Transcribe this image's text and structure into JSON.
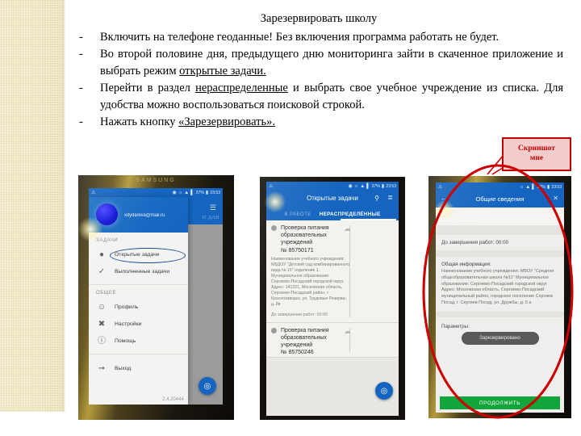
{
  "document": {
    "title": "Зарезервировать школу",
    "bullets": [
      {
        "dash": "-",
        "parts": [
          {
            "t": "Включить на телефоне геоданные! Без включения программа работать не будет.",
            "u": false
          }
        ]
      },
      {
        "dash": "-",
        "parts": [
          {
            "t": "Во второй половине дня, предыдущего дню мониторинга зайти в скаченное приложение и выбрать режим ",
            "u": false
          },
          {
            "t": "открытые задачи.",
            "u": true
          }
        ]
      },
      {
        "dash": "-",
        "parts": [
          {
            "t": "Перейти в раздел ",
            "u": false
          },
          {
            "t": "нераспределенные",
            "u": true
          },
          {
            "t": " и выбрать свое учебное учреждение из списка. Для удобства можно воспользоваться поисковой строкой.",
            "u": false
          }
        ]
      },
      {
        "dash": "-",
        "parts": [
          {
            "t": "Нажать кнопку ",
            "u": false
          },
          {
            "t": "«Зарезервировать».",
            "u": true
          }
        ]
      }
    ]
  },
  "callout": {
    "line1": "Скриншот",
    "line2": "мне",
    "fill": "#f4cccc",
    "stroke": "#c00000"
  },
  "annotation": {
    "ellipse_color": "#cc0000"
  },
  "statusbar": {
    "battery": "37%",
    "clock": "23:53",
    "warning_icon": "warning-triangle-icon",
    "location_icon": "location-pin-icon",
    "bluetooth_icon": "bluetooth-icon",
    "wifi_icon": "wifi-icon",
    "signal_icon": "signal-bars-icon",
    "battery_icon": "battery-icon"
  },
  "phone1": {
    "brand": "SAMSUNG",
    "drawer": {
      "email": "xdydareva@mail.ru",
      "avatar_icon": "user-avatar",
      "sections": [
        {
          "label": "ЗАДАЧИ",
          "items": [
            {
              "label": "Открытые задачи",
              "icon": "location-pin-icon",
              "highlighted": true
            },
            {
              "label": "Выполненные задачи",
              "icon": "check-circle-icon",
              "highlighted": false
            }
          ]
        },
        {
          "label": "ОБЩЕЕ",
          "items": [
            {
              "label": "Профиль",
              "icon": "person-icon",
              "highlighted": false
            },
            {
              "label": "Настройки",
              "icon": "tools-icon",
              "highlighted": false
            },
            {
              "label": "Помощь",
              "icon": "info-icon",
              "highlighted": false
            }
          ]
        }
      ],
      "logout": {
        "label": "Выход",
        "icon": "logout-icon"
      },
      "version": "2.4.20444"
    },
    "menu_icon": "hamburger-menu-icon",
    "fab_icon": "location-pin-icon"
  },
  "phone2": {
    "appbar": {
      "title": "Открытые задачи",
      "search_icon": "search-icon",
      "filter_icon": "filter-icon"
    },
    "tabs": [
      {
        "label": "В РАБОТЕ",
        "active": false
      },
      {
        "label": "НЕРАСПРЕДЕЛЁННЫЕ",
        "active": true
      }
    ],
    "cards": [
      {
        "title": "Проверка питания образовательных учреждений",
        "number": "№ 85750171",
        "body": "Наименование учебного учреждения: МБДОУ \"Детский сад комбинированного вида № 15\" отделение 1. Муниципальное образование: Сергиево-Посадский городской округ. Адрес: 141321, Московская область, Сергиево-Посадский район, г. Краснозаводск, ул. Трудовые Резервы, д. 8в",
        "footer": "До завершения работ: 00:00",
        "cloud_icon": "cloud-icon"
      },
      {
        "title": "Проверка питания образовательных учреждений",
        "number": "№ 85750246",
        "body": "",
        "footer": "",
        "cloud_icon": "cloud-icon"
      }
    ],
    "fab_icon": "location-pin-icon"
  },
  "phone3": {
    "appbar": {
      "title": "Общие сведения",
      "back_icon": "arrow-back-icon",
      "close_icon": "close-icon"
    },
    "deadline": "До завершения работ: 00:00",
    "info_heading": "Общая информация:",
    "info_text": "Наименование учебного учреждения: МБОУ \"Средняя общеобразовательная школа №11\" Муниципальное образование: Сергиево-Посадский городской округ Адрес: Московская область, Сергиево-Посадский муниципальный район, городское поселение Сергиев Посад, г. Сергиев Посад, ул. Дружбы, д. 5 а",
    "params_label": "Параметры:",
    "reserved_button": "Зарезервировано",
    "continue_button": "ПРОДОЛЖИТЬ",
    "continue_color": "#12a53c"
  }
}
